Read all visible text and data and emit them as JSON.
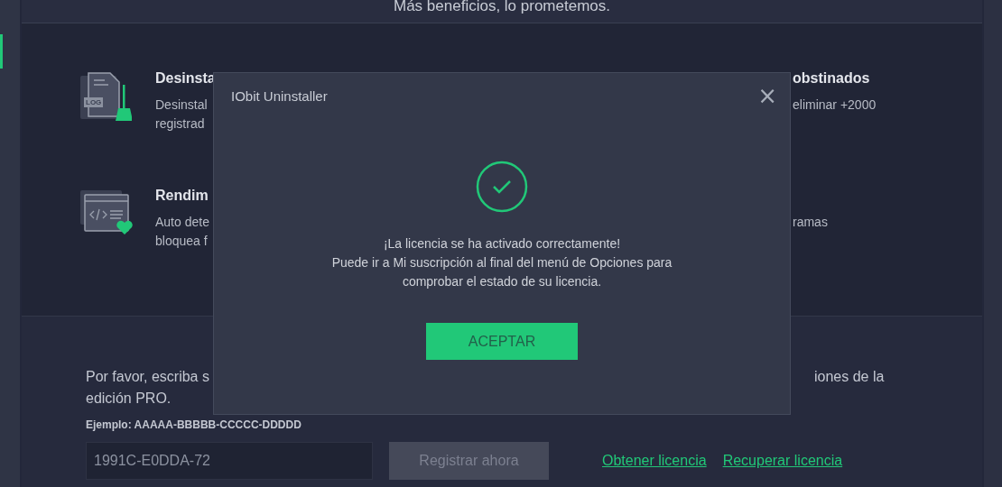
{
  "header": {
    "tagline": "Más beneficios, lo prometemos."
  },
  "features": [
    {
      "kind": "log",
      "badge": "LOG",
      "title": "Desinsta",
      "lines": [
        "Desinstal",
        "registrad"
      ]
    },
    {
      "kind": "none",
      "title": "obstinados",
      "lines": [
        "eliminar +2000"
      ]
    },
    {
      "kind": "code",
      "title": "Rendim",
      "lines": [
        "Auto dete",
        "bloquea f"
      ]
    },
    {
      "kind": "none",
      "lines": [
        "ramas"
      ]
    }
  ],
  "register": {
    "intro_left": [
      "Por favor, escriba s",
      "edición PRO."
    ],
    "intro_right": "iones de la",
    "example": "Ejemplo: AAAAA-BBBBB-CCCCC-DDDDD",
    "code_value": "1991C-E0DDA-72",
    "register_button": {
      "label": "Registrar ahora",
      "disabled": true
    },
    "links": [
      "Obtener licencia",
      "Recuperar licencia"
    ]
  },
  "dialog": {
    "title": "IObit Uninstaller",
    "close": "×",
    "message": [
      "¡La licencia se ha activado correctamente!",
      "Puede ir a Mi suscripción al final del menú de Opciones para",
      "comprobar el estado de su licencia."
    ],
    "ok": "ACEPTAR"
  }
}
